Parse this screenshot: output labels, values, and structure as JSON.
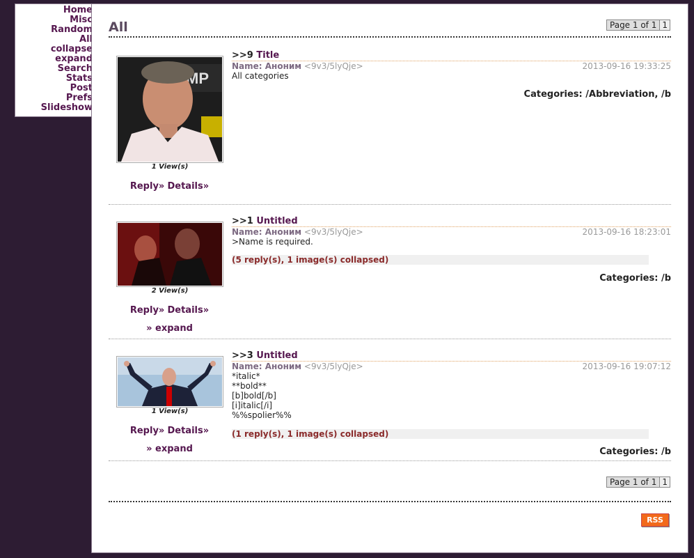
{
  "nav": {
    "items": [
      "Home",
      "Misc",
      "Random",
      "All",
      "collapse",
      "expand",
      "Search",
      "Stats",
      "Post",
      "Prefs",
      "Slideshow"
    ]
  },
  "page": {
    "title": "All",
    "pager_top": "Page 1 of 1",
    "pager_top_num": "1",
    "pager_bottom": "Page 1 of 1",
    "pager_bottom_num": "1",
    "rss": "RSS"
  },
  "posts": [
    {
      "num": ">>9",
      "subject": "Title",
      "name_label": "Name: Аноним",
      "trip": "<9v3/5lyQje>",
      "date": "2013-09-16 19:33:25",
      "body": "All categories",
      "views": "1 View(s)",
      "reply": "Reply»",
      "details": "Details»",
      "categories": "Categories: /Abbreviation, /b"
    },
    {
      "num": ">>1",
      "subject": "Untitled",
      "name_label": "Name: Аноним",
      "trip": "<9v3/5lyQje>",
      "date": "2013-09-16 18:23:01",
      "body": ">Name is required.",
      "views": "2 View(s)",
      "reply": "Reply»",
      "details": "Details»",
      "expand": "» expand",
      "collapsed": "(5 reply(s), 1 image(s) collapsed)",
      "categories": "Categories: /b"
    },
    {
      "num": ">>3",
      "subject": "Untitled",
      "name_label": "Name: Аноним",
      "trip": "<9v3/5lyQje>",
      "date": "2013-09-16 19:07:12",
      "body": "*italic*\n**bold**\n[b]bold[/b]\n[i]italic[/i]\n%%spolier%%",
      "views": "1 View(s)",
      "reply": "Reply»",
      "details": "Details»",
      "expand": "» expand",
      "collapsed": "(1 reply(s), 1 image(s) collapsed)",
      "categories": "Categories: /b"
    }
  ]
}
